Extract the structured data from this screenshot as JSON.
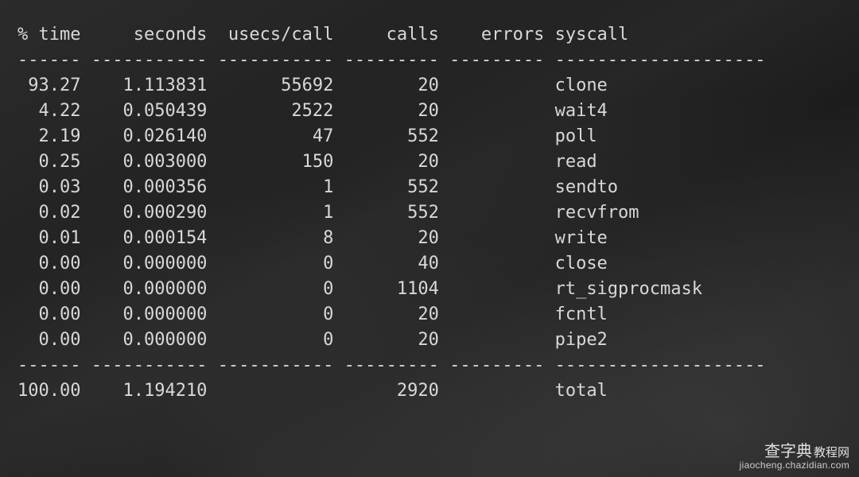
{
  "columns": {
    "pct_time": {
      "label": "% time",
      "width": 6,
      "align": "right",
      "dash": 6
    },
    "seconds": {
      "label": "seconds",
      "width": 11,
      "align": "right",
      "dash": 11
    },
    "usecs_call": {
      "label": "usecs/call",
      "width": 11,
      "align": "right",
      "dash": 11
    },
    "calls": {
      "label": "calls",
      "width": 9,
      "align": "right",
      "dash": 9
    },
    "errors": {
      "label": "errors",
      "width": 9,
      "align": "right",
      "dash": 9
    },
    "syscall": {
      "label": "syscall",
      "width": 20,
      "align": "left",
      "dash": 20
    }
  },
  "column_order": [
    "pct_time",
    "seconds",
    "usecs_call",
    "calls",
    "errors",
    "syscall"
  ],
  "rows": [
    {
      "pct_time": "93.27",
      "seconds": "1.113831",
      "usecs_call": "55692",
      "calls": "20",
      "errors": "",
      "syscall": "clone"
    },
    {
      "pct_time": "4.22",
      "seconds": "0.050439",
      "usecs_call": "2522",
      "calls": "20",
      "errors": "",
      "syscall": "wait4"
    },
    {
      "pct_time": "2.19",
      "seconds": "0.026140",
      "usecs_call": "47",
      "calls": "552",
      "errors": "",
      "syscall": "poll"
    },
    {
      "pct_time": "0.25",
      "seconds": "0.003000",
      "usecs_call": "150",
      "calls": "20",
      "errors": "",
      "syscall": "read"
    },
    {
      "pct_time": "0.03",
      "seconds": "0.000356",
      "usecs_call": "1",
      "calls": "552",
      "errors": "",
      "syscall": "sendto"
    },
    {
      "pct_time": "0.02",
      "seconds": "0.000290",
      "usecs_call": "1",
      "calls": "552",
      "errors": "",
      "syscall": "recvfrom"
    },
    {
      "pct_time": "0.01",
      "seconds": "0.000154",
      "usecs_call": "8",
      "calls": "20",
      "errors": "",
      "syscall": "write"
    },
    {
      "pct_time": "0.00",
      "seconds": "0.000000",
      "usecs_call": "0",
      "calls": "40",
      "errors": "",
      "syscall": "close"
    },
    {
      "pct_time": "0.00",
      "seconds": "0.000000",
      "usecs_call": "0",
      "calls": "1104",
      "errors": "",
      "syscall": "rt_sigprocmask"
    },
    {
      "pct_time": "0.00",
      "seconds": "0.000000",
      "usecs_call": "0",
      "calls": "20",
      "errors": "",
      "syscall": "fcntl"
    },
    {
      "pct_time": "0.00",
      "seconds": "0.000000",
      "usecs_call": "0",
      "calls": "20",
      "errors": "",
      "syscall": "pipe2"
    }
  ],
  "total": {
    "pct_time": "100.00",
    "seconds": "1.194210",
    "usecs_call": "",
    "calls": "2920",
    "errors": "",
    "syscall": "total"
  },
  "watermark": {
    "title_cn": "查字典",
    "title_suffix": "教程网",
    "url": "jiaocheng.chazidian.com"
  }
}
